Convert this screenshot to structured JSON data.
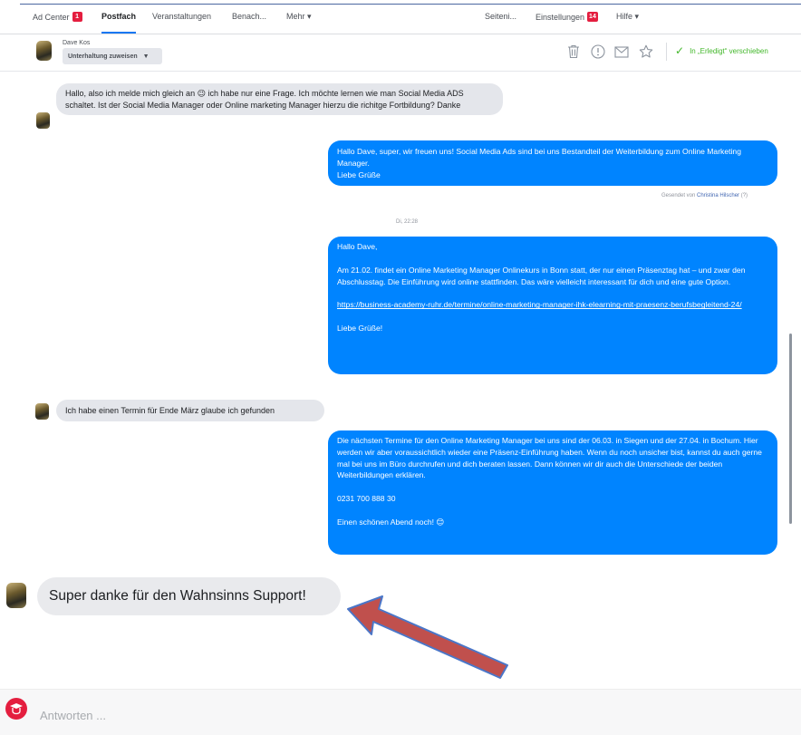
{
  "nav": {
    "items": [
      {
        "label": "Ad Center",
        "badge": "1"
      },
      {
        "label": "Postfach",
        "active": true
      },
      {
        "label": "Veranstaltungen"
      },
      {
        "label": "Benach..."
      },
      {
        "label": "Mehr ▾"
      }
    ],
    "right_items": [
      {
        "label": "Seiteni..."
      },
      {
        "label": "Einstellungen",
        "badge": "14"
      },
      {
        "label": "Hilfe ▾"
      }
    ]
  },
  "conversation": {
    "contact_name": "Dave Kos",
    "assign_label": "Unterhaltung zuweisen",
    "assign_chevron": "▼",
    "icons": [
      "trash-icon",
      "alert-icon",
      "mail-icon",
      "star-icon"
    ],
    "done_label": "In „Erledigt“ verschieben"
  },
  "messages": {
    "m1": "Hallo, also ich melde mich gleich an 😉 ich habe nur eine Frage. Ich möchte lernen wie man Social Media ADS schaltet. Ist der Social Media Manager oder Online marketing Manager hierzu die richitge Fortbildung? Danke",
    "m2": "Hallo Dave, super, wir freuen uns! Social Media Ads sind bei uns Bestandteil der Weiterbildung zum Online Marketing Manager.\nLiebe Grüße",
    "m2_meta_prefix": "Gesendet von",
    "m2_meta_author": "Christina Hilscher",
    "m2_meta_suffix": "(?)",
    "timestamp": "Di, 22:28",
    "m3_greeting": "Hallo Dave,",
    "m3_body": "Am 21.02. findet ein Online Marketing Manager Onlinekurs in Bonn statt, der nur einen Präsenztag hat – und zwar den Abschlusstag. Die Einführung wird online stattfinden. Das wäre vielleicht interessant für dich und eine gute Option.",
    "m3_link": "https://business-academy-ruhr.de/termine/online-marketing-manager-ihk-elearning-mit-praesenz-berufsbegleitend-24/",
    "m3_signoff": "Liebe Grüße!",
    "m4": "Ich habe einen Termin für Ende März glaube ich gefunden",
    "m5_body": "Die nächsten Termine für den Online Marketing Manager bei uns sind der 06.03. in Siegen und der 27.04. in Bochum.   Hier werden wir aber voraussichtlich wieder eine Präsenz-Einführung haben. Wenn du noch unsicher bist, kannst du auch gerne mal bei uns im Büro durchrufen und dich beraten lassen. Dann können wir dir auch die Unterschiede der beiden Weiterbildungen erklären.",
    "m5_phone": "0231 700 888 30",
    "m5_signoff": "Einen schönen Abend noch! 😊"
  },
  "highlight": {
    "message": "Super danke für den Wahnsinns Support!"
  },
  "reply": {
    "placeholder": "Antworten ..."
  },
  "colors": {
    "outgoing_bubble": "#0084ff",
    "incoming_bubble": "#e4e6eb",
    "arrow_fill": "#c0504d",
    "arrow_stroke": "#4a76c8",
    "done_green": "#42b72a",
    "badge_red": "#e41e3f"
  }
}
